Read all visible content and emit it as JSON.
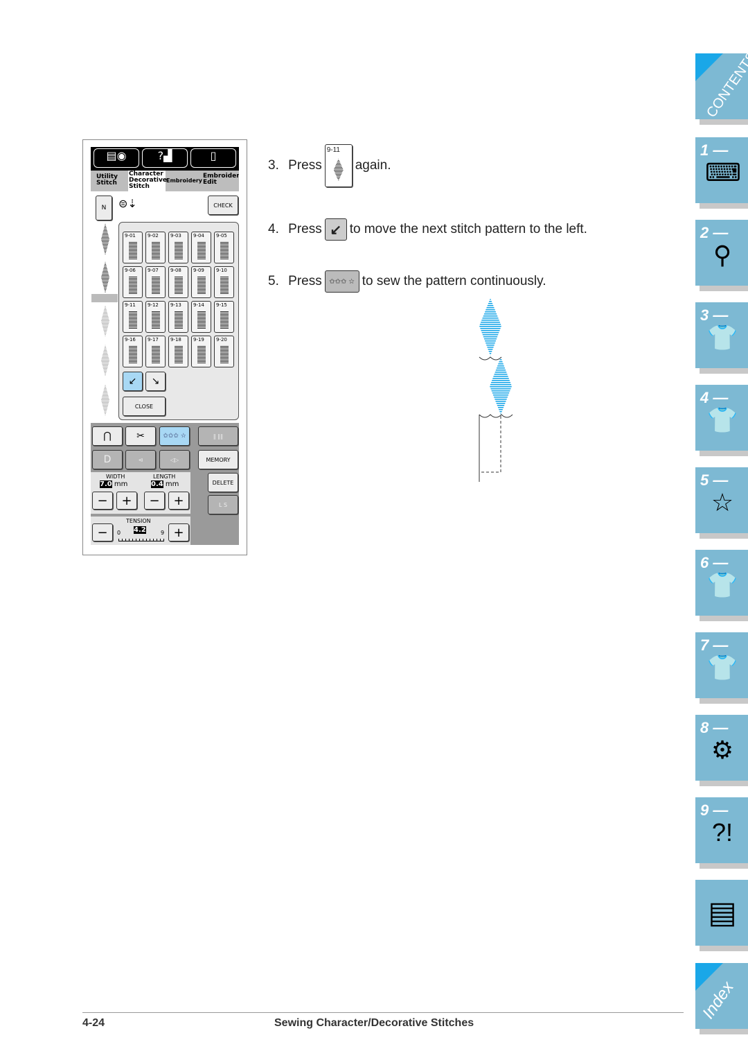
{
  "lcd": {
    "top_tabs": [
      "Utility Stitch",
      "Character Decorative Stitch",
      "Embroidery",
      "Embroidery Edit"
    ],
    "check": "CHECK",
    "stitches": [
      "9-01",
      "9-02",
      "9-03",
      "9-04",
      "9-05",
      "9-06",
      "9-07",
      "9-08",
      "9-09",
      "9-10",
      "9-11",
      "9-12",
      "9-13",
      "9-14",
      "9-15",
      "9-16",
      "9-17",
      "9-18",
      "9-19",
      "9-20"
    ],
    "selected_stitch": "9-11",
    "close": "CLOSE",
    "memory": "MEMORY",
    "delete": "DELETE",
    "ls": "L  S",
    "width_label": "WIDTH",
    "width_value": "7.0",
    "length_label": "LENGTH",
    "length_value": "0.4",
    "unit": "mm",
    "tension_label": "TENSION",
    "tension_value": "4.2",
    "tension_min": "0",
    "tension_max": "9",
    "minus": "−",
    "plus": "+"
  },
  "steps": [
    {
      "num": "3.",
      "press": "Press",
      "key": "9-11",
      "text": "again."
    },
    {
      "num": "4.",
      "press": "Press",
      "text": "to move the next stitch pattern to the left."
    },
    {
      "num": "5.",
      "press": "Press",
      "text": "to sew the pattern continuously."
    }
  ],
  "tabs": {
    "contents": "CONTENTS",
    "chapters": [
      "1 —",
      "2 —",
      "3 —",
      "4 —",
      "5 —",
      "6 —",
      "7 —",
      "8 —",
      "9 —"
    ],
    "index": "Index"
  },
  "footer": {
    "page": "4-24",
    "title": "Sewing Character/Decorative Stitches"
  },
  "colors": {
    "accent": "#1aa7e8",
    "tab": "#7db9d3",
    "selected": "#a8d8f4"
  }
}
